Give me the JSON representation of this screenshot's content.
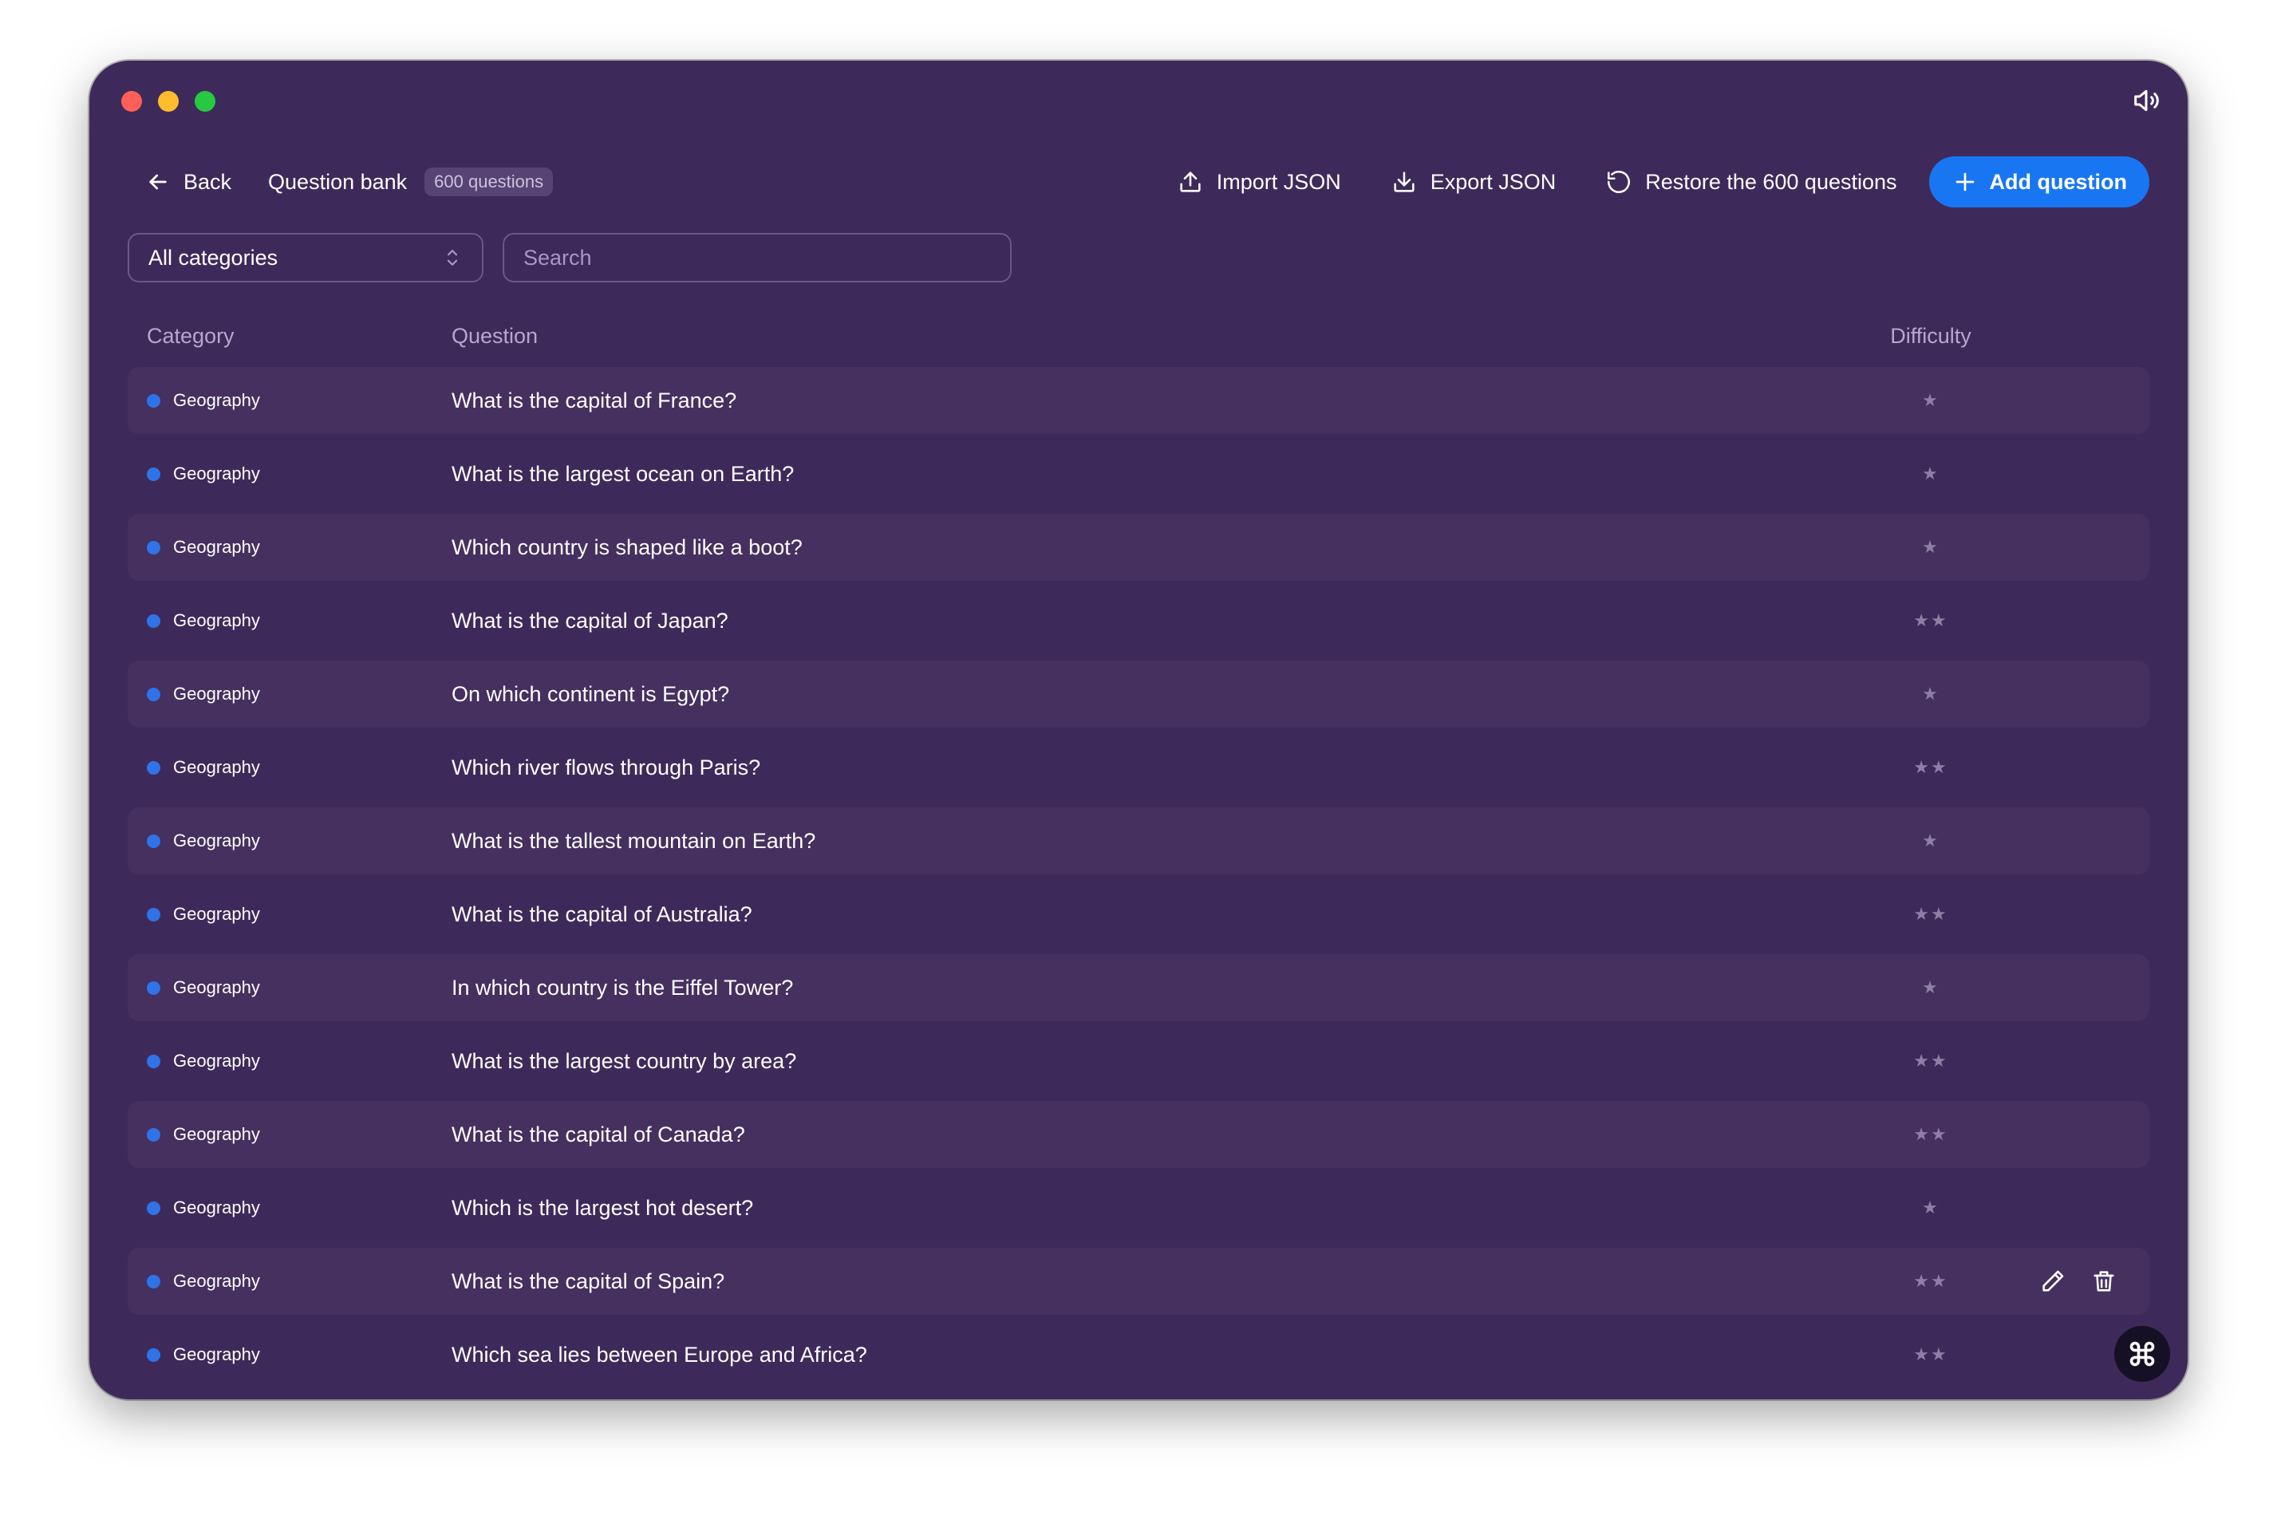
{
  "header": {
    "back_label": "Back",
    "title": "Question bank",
    "count_badge": "600 questions",
    "import_label": "Import JSON",
    "export_label": "Export JSON",
    "restore_label": "Restore the 600 questions",
    "add_label": "Add question"
  },
  "filters": {
    "category_selected": "All categories",
    "search_placeholder": "Search"
  },
  "table": {
    "columns": {
      "category": "Category",
      "question": "Question",
      "difficulty": "Difficulty"
    },
    "rows": [
      {
        "category": "Geography",
        "question": "What is the capital of France?",
        "difficulty": 1
      },
      {
        "category": "Geography",
        "question": "What is the largest ocean on Earth?",
        "difficulty": 1
      },
      {
        "category": "Geography",
        "question": "Which country is shaped like a boot?",
        "difficulty": 1
      },
      {
        "category": "Geography",
        "question": "What is the capital of Japan?",
        "difficulty": 2
      },
      {
        "category": "Geography",
        "question": "On which continent is Egypt?",
        "difficulty": 1
      },
      {
        "category": "Geography",
        "question": "Which river flows through Paris?",
        "difficulty": 2
      },
      {
        "category": "Geography",
        "question": "What is the tallest mountain on Earth?",
        "difficulty": 1
      },
      {
        "category": "Geography",
        "question": "What is the capital of Australia?",
        "difficulty": 2
      },
      {
        "category": "Geography",
        "question": "In which country is the Eiffel Tower?",
        "difficulty": 1
      },
      {
        "category": "Geography",
        "question": "What is the largest country by area?",
        "difficulty": 2
      },
      {
        "category": "Geography",
        "question": "What is the capital of Canada?",
        "difficulty": 2
      },
      {
        "category": "Geography",
        "question": "Which is the largest hot desert?",
        "difficulty": 1
      },
      {
        "category": "Geography",
        "question": "What is the capital of Spain?",
        "difficulty": 2
      },
      {
        "category": "Geography",
        "question": "Which sea lies between Europe and Africa?",
        "difficulty": 2
      }
    ]
  },
  "hovered_row": 12,
  "colors": {
    "accent": "#1976f2",
    "category_dot": "#2f73e8",
    "window_bg": "#3e2a5a"
  },
  "icons": {
    "back": "arrow-left-icon",
    "import": "upload-icon",
    "export": "download-icon",
    "restore": "rotate-ccw-icon",
    "add": "plus-icon",
    "select": "chevron-up-down-icon",
    "sound": "speaker-icon",
    "edit": "pencil-icon",
    "delete": "trash-icon",
    "floating": "command-icon"
  }
}
